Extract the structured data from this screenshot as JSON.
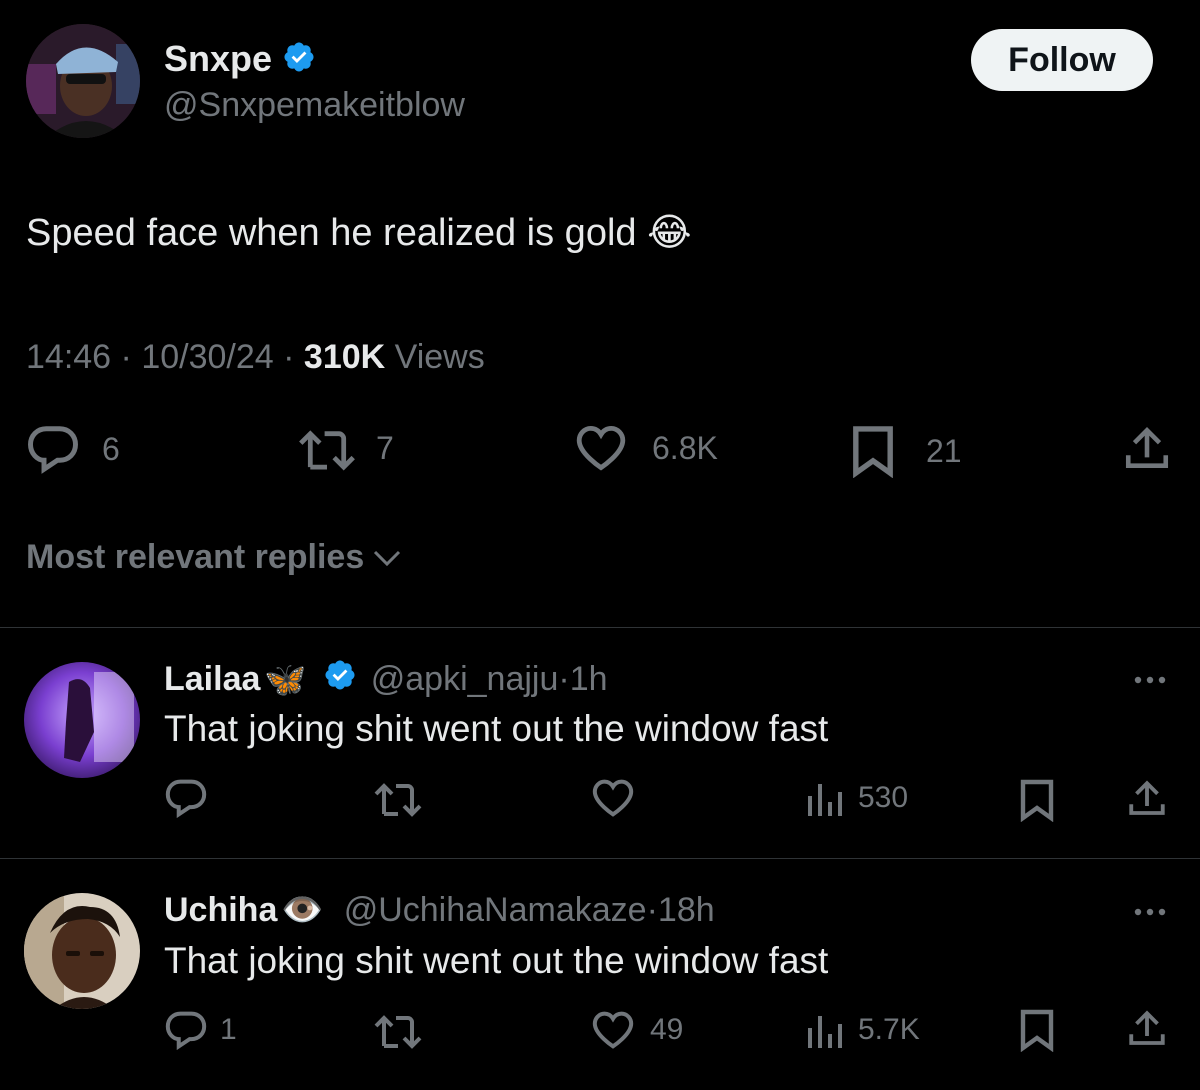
{
  "tweet": {
    "display_name": "Snxpe",
    "handle": "@Snxpemakeitblow",
    "follow_label": "Follow",
    "text": "Speed face when he realized is gold",
    "emoji": "😂",
    "time": "14:46",
    "date": "10/30/24",
    "views_count": "310K",
    "views_label": "Views",
    "replies": "6",
    "reposts": "7",
    "likes": "6.8K",
    "bookmarks": "21"
  },
  "replies_section": {
    "sort_label": "Most relevant replies"
  },
  "replies": [
    {
      "display_name": "Lailaa",
      "name_emoji": "🦋",
      "handle": "@apki_najju",
      "age": "1h",
      "text": "That joking shit went out the window fast",
      "reply_count": "",
      "repost_count": "",
      "like_count": "",
      "views": "530"
    },
    {
      "display_name": "Uchiha",
      "name_emoji": "👁️",
      "handle": "@UchihaNamakaze",
      "age": "18h",
      "text": "That joking shit went out the window fast",
      "reply_count": "1",
      "repost_count": "",
      "like_count": "49",
      "views": "5.7K"
    }
  ],
  "colors": {
    "background": "#000000",
    "text": "#e7e9ea",
    "muted": "#71767b",
    "verified_blue": "#1d9bf0",
    "divider": "#2f3336"
  },
  "icons": {
    "reply": "speech-bubble",
    "repost": "arrows-loop",
    "like": "heart-outline",
    "bookmark": "bookmark-outline",
    "share": "upload-arrow",
    "views": "bar-chart",
    "more": "three-dots",
    "verified": "blue-check-badge",
    "sort": "chevron-down"
  }
}
